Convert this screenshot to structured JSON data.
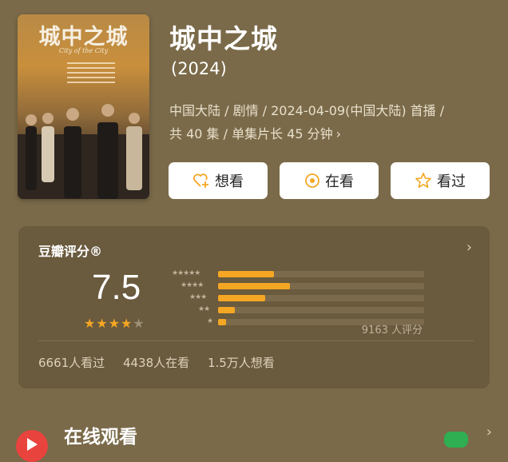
{
  "poster": {
    "title": "城中之城",
    "subtitle": "City of the City"
  },
  "movie": {
    "title": "城中之城",
    "year": "(2024)",
    "meta_line1": "中国大陆 / 剧情 / 2024-04-09(中国大陆) 首播 /",
    "meta_line2": "共 40 集 / 单集片长 45 分钟"
  },
  "actions": {
    "want_label": "想看",
    "watching_label": "在看",
    "watched_label": "看过"
  },
  "rating": {
    "header": "豆瓣评分®",
    "score": "7.5",
    "stars_filled": 4,
    "stars_total": 5,
    "distribution": [
      {
        "stars": 5,
        "percent": 27
      },
      {
        "stars": 4,
        "percent": 35
      },
      {
        "stars": 3,
        "percent": 23
      },
      {
        "stars": 2,
        "percent": 8
      },
      {
        "stars": 1,
        "percent": 4
      }
    ],
    "rating_count": "9163 人评分",
    "stat_watched": "6661人看过",
    "stat_watching": "4438人在看",
    "stat_want": "1.5万人想看"
  },
  "online": {
    "title": "在线观看"
  },
  "colors": {
    "background": "#7a6a49",
    "card": "#6a5a3e",
    "accent_star": "#f5a623",
    "play_red": "#e9433d",
    "badge_green": "#2fae52"
  }
}
